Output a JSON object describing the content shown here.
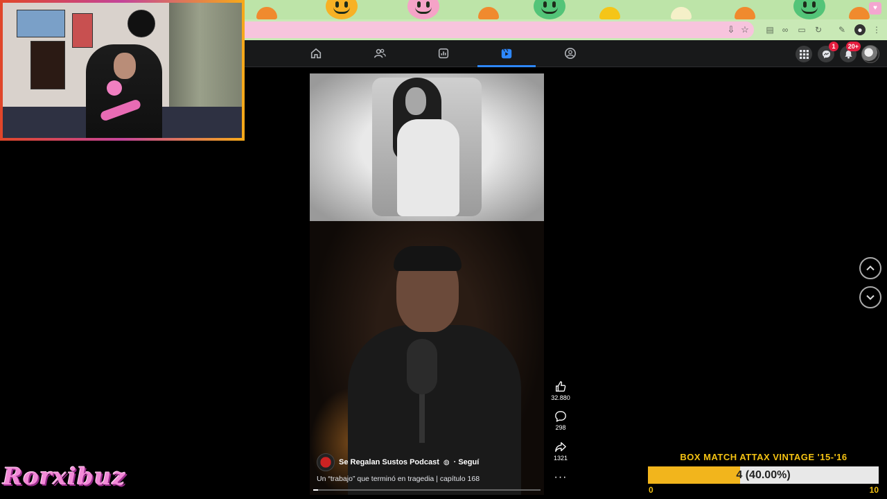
{
  "browser": {
    "tab_pill_icon": "heart-icon",
    "toolbar_icons": [
      "install-icon",
      "bookmark-star-icon",
      "translate-icon",
      "link-icon",
      "reader-icon",
      "sync-icon",
      "extension-icon",
      "profile-icon",
      "menu-icon"
    ]
  },
  "facebook_nav": {
    "tabs": [
      "home-icon",
      "friends-icon",
      "dashboard-icon",
      "reels-icon",
      "groups-icon"
    ],
    "active_tab": "reels-icon",
    "messenger_badge": "1",
    "notifications_badge": "20+",
    "accent_color": "#2d88ff"
  },
  "reel": {
    "author": "Se Regalan Sustos Podcast",
    "verified_icon": "verified-icon",
    "follow": "· Seguí",
    "caption": "Un “trabajo” que terminó en tragedia | capítulo 168",
    "progress": 0.02
  },
  "actions": {
    "likes": "32.880",
    "comments": "298",
    "shares": "1321",
    "more": "···"
  },
  "overlay": {
    "brand": "Rorxibuz",
    "goal_title": "BOX MATCH ATTAX VINTAGE '15-'16",
    "goal_current": "4",
    "goal_percent_label": "(40.00%)",
    "goal_fraction": 0.4,
    "goal_min": "0",
    "goal_max": "10",
    "goal_color": "#f2b51c"
  }
}
